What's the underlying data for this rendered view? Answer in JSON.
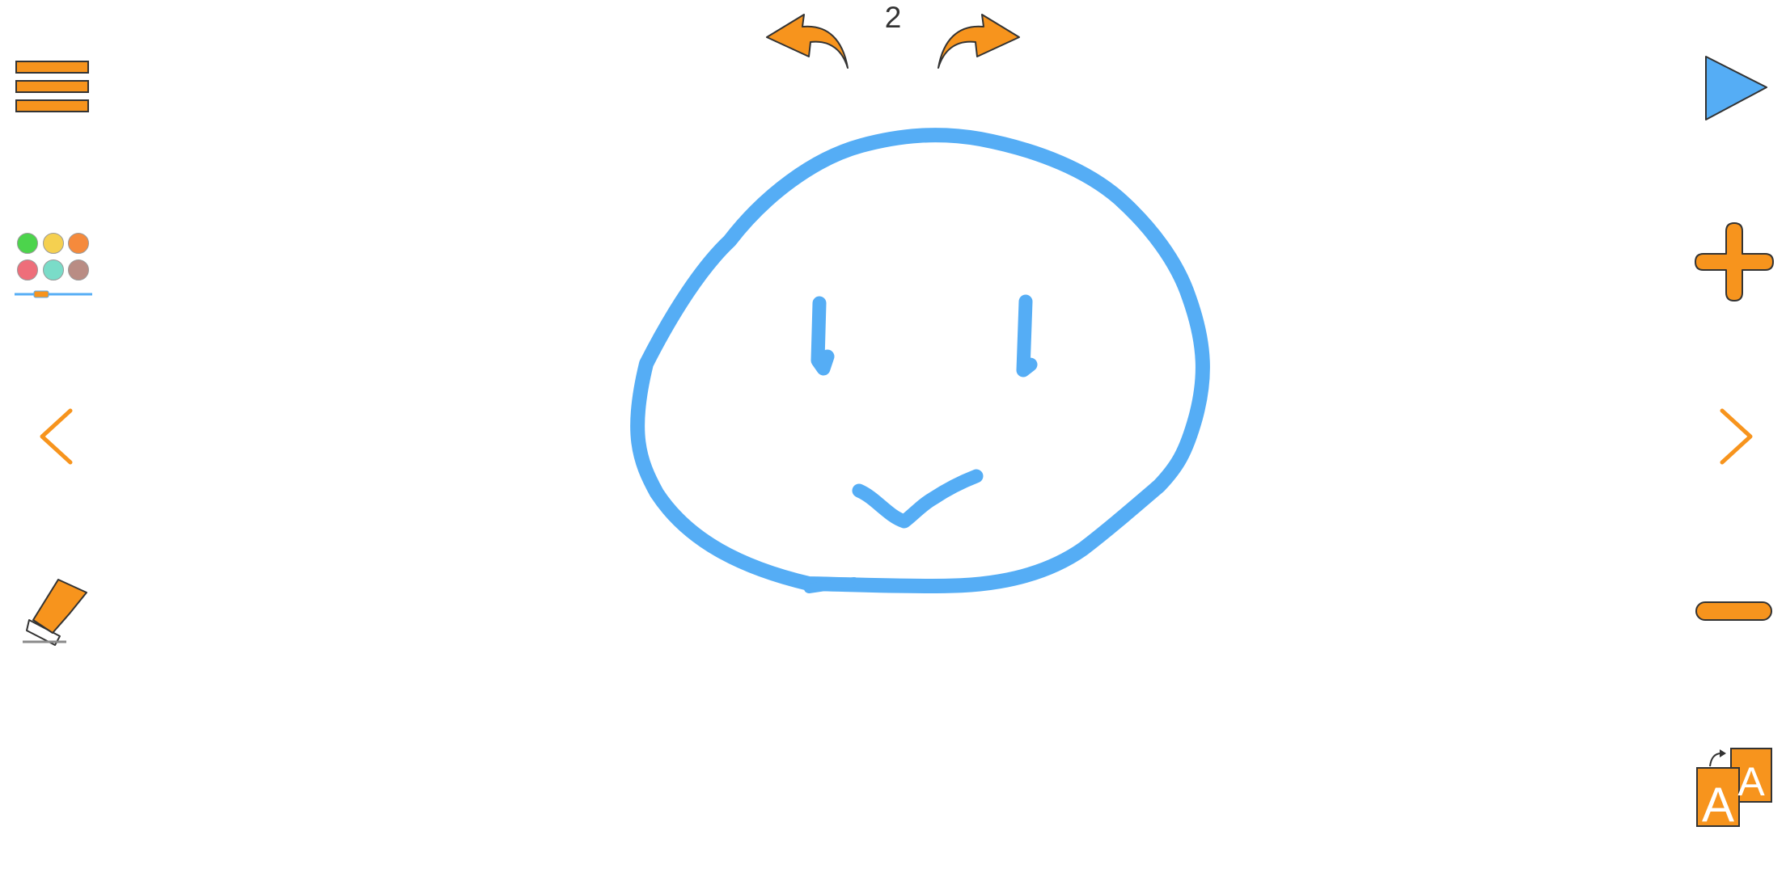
{
  "toolbar": {
    "page_number": "2",
    "undo_icon": "undo-arrow-icon",
    "redo_icon": "redo-arrow-icon"
  },
  "left_panel": {
    "menu_icon": "hamburger-menu-icon",
    "palette_icon": "color-palette-icon",
    "palette_colors": [
      "#4cd44c",
      "#f5d050",
      "#f58a3c",
      "#ee6e7a",
      "#7adcc8",
      "#b98c84"
    ],
    "brush_size_icon": "brush-size-slider-icon",
    "previous_icon": "chevron-left-icon",
    "eraser_icon": "eraser-icon"
  },
  "right_panel": {
    "play_icon": "play-icon",
    "zoom_in_icon": "plus-icon",
    "next_icon": "chevron-right-icon",
    "zoom_out_icon": "minus-icon",
    "font_switch_icon": "font-switch-icon",
    "font_switch_letters": [
      "A",
      "A"
    ]
  },
  "canvas": {
    "drawing": "smiley-face-sketch",
    "stroke_color": "#55adf5"
  },
  "colors": {
    "accent_orange": "#f7941d",
    "play_blue": "#55adf5",
    "outline": "#333333"
  }
}
